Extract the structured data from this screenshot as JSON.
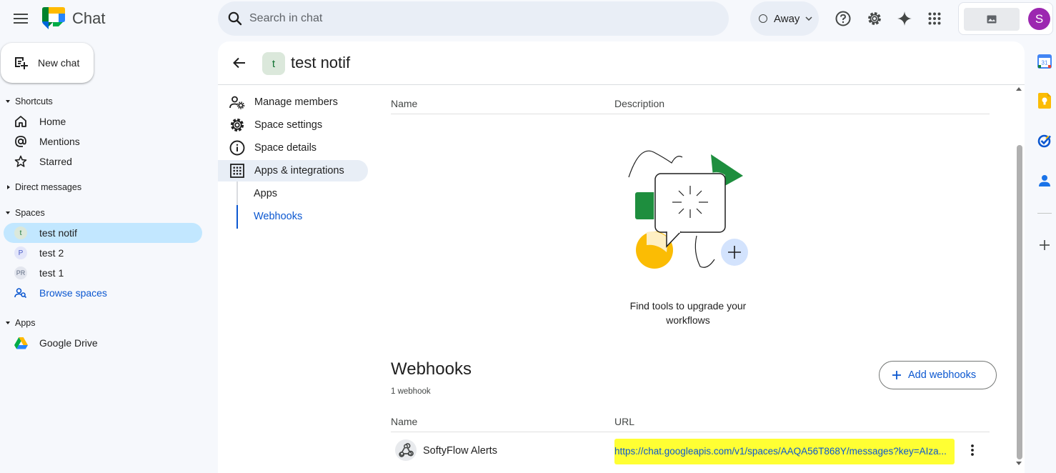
{
  "app": {
    "name": "Chat"
  },
  "search": {
    "placeholder": "Search in chat",
    "value": ""
  },
  "status": {
    "label": "Away"
  },
  "account": {
    "initial": "S",
    "avatar_color": "#9c27b0"
  },
  "sidebar": {
    "new_chat_label": "New chat",
    "sections": {
      "shortcuts": "Shortcuts",
      "direct_messages": "Direct messages",
      "spaces": "Spaces",
      "apps": "Apps"
    },
    "shortcuts": [
      {
        "label": "Home",
        "icon": "home-icon"
      },
      {
        "label": "Mentions",
        "icon": "at-icon"
      },
      {
        "label": "Starred",
        "icon": "star-icon"
      }
    ],
    "spaces": [
      {
        "label": "test notif",
        "avatar": "t",
        "selected": true
      },
      {
        "label": "test 2",
        "avatar": "P",
        "selected": false
      },
      {
        "label": "test 1",
        "avatar": "PR",
        "selected": false
      }
    ],
    "browse_spaces_label": "Browse spaces",
    "apps": [
      {
        "label": "Google Drive",
        "icon": "google-drive-icon"
      }
    ]
  },
  "space": {
    "title": "test notif",
    "avatar": "t"
  },
  "settings_nav": {
    "items": [
      {
        "label": "Manage members",
        "icon": "manage-members-icon"
      },
      {
        "label": "Space settings",
        "icon": "gear-icon"
      },
      {
        "label": "Space details",
        "icon": "info-icon"
      },
      {
        "label": "Apps & integrations",
        "icon": "apps-grid-icon",
        "selected": true
      }
    ],
    "sub_items": [
      {
        "label": "Apps",
        "active": false
      },
      {
        "label": "Webhooks",
        "active": true
      }
    ]
  },
  "apps_table": {
    "col_name": "Name",
    "col_description": "Description",
    "empty_text": "Find tools to upgrade your workflows"
  },
  "webhooks": {
    "title": "Webhooks",
    "count_text": "1 webhook",
    "add_label": "Add webhooks",
    "col_name": "Name",
    "col_url": "URL",
    "rows": [
      {
        "name": "SoftyFlow Alerts",
        "url": "https://chat.googleapis.com/v1/spaces/AAQA56T868Y/messages?key=AIza..."
      }
    ]
  },
  "colors": {
    "accent": "#0b57d0",
    "selected_bg": "#c2e7ff",
    "highlight": "#ffff33"
  }
}
